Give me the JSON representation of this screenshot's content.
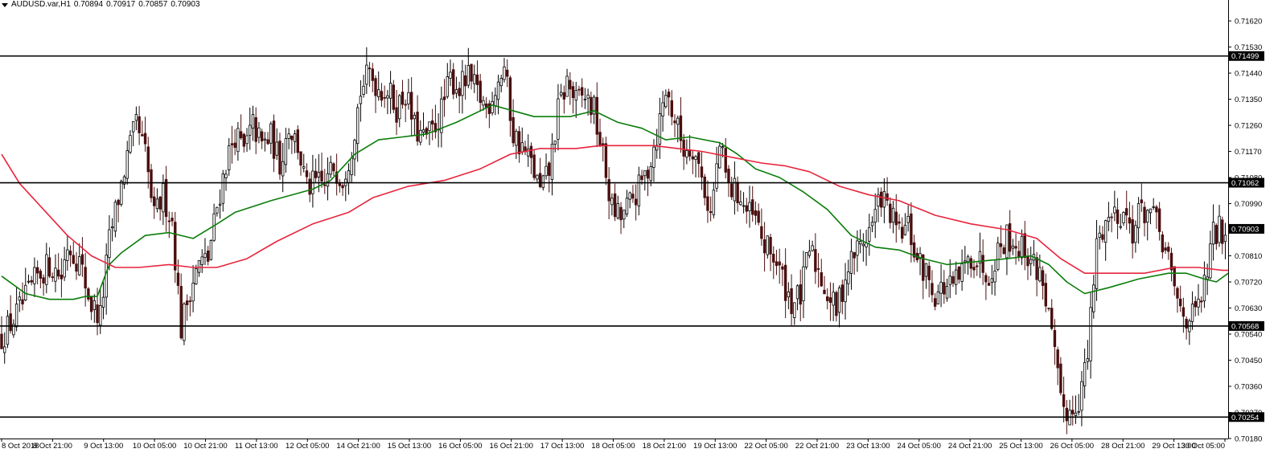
{
  "header": {
    "symbol": "AUDUSD.var,H1",
    "open": "0.70894",
    "high": "0.70917",
    "low": "0.70857",
    "close": "0.70903",
    "menu_icon": "triangle-down-icon"
  },
  "colors": {
    "background": "#ffffff",
    "axis": "#000000",
    "bull_candle": "#000000",
    "bear_candle": "#4a0f0f",
    "ma_fast": "#0a7d0a",
    "ma_slow": "#e8243c",
    "level_line": "#000000",
    "level_label_bg": "#000000",
    "level_label_text": "#ffffff"
  },
  "chart_data": {
    "type": "candlestick",
    "symbol": "AUDUSD",
    "timeframe": "H1",
    "ylim": [
      0.7018,
      0.7167
    ],
    "y_ticks": [
      "0.71620",
      "0.71530",
      "0.71440",
      "0.71350",
      "0.71260",
      "0.71170",
      "0.71080",
      "0.70990",
      "0.70900",
      "0.70810",
      "0.70720",
      "0.70630",
      "0.70540",
      "0.70450",
      "0.70360",
      "0.70270",
      "0.70180"
    ],
    "x_ticks": [
      "8 Oct 2018",
      "8 Oct 21:00",
      "9 Oct 13:00",
      "10 Oct 05:00",
      "10 Oct 21:00",
      "11 Oct 13:00",
      "12 Oct 05:00",
      "14 Oct 21:00",
      "15 Oct 13:00",
      "16 Oct 05:00",
      "16 Oct 21:00",
      "17 Oct 13:00",
      "18 Oct 05:00",
      "18 Oct 21:00",
      "19 Oct 13:00",
      "22 Oct 05:00",
      "22 Oct 21:00",
      "23 Oct 13:00",
      "24 Oct 05:00",
      "24 Oct 21:00",
      "25 Oct 13:00",
      "26 Oct 05:00",
      "28 Oct 21:00",
      "29 Oct 13:00",
      "30 Oct 05:00"
    ],
    "horizontal_levels": [
      {
        "value": 0.71499,
        "label": "0.71499"
      },
      {
        "value": 0.71062,
        "label": "0.71062"
      },
      {
        "value": 0.70568,
        "label": "0.70568"
      },
      {
        "value": 0.70254,
        "label": "0.70254"
      }
    ],
    "current_price": {
      "value": 0.70903,
      "label": "0.70903"
    },
    "close_anchors": [
      [
        0,
        0.7053
      ],
      [
        4,
        0.7059
      ],
      [
        8,
        0.7066
      ],
      [
        12,
        0.7074
      ],
      [
        16,
        0.7078
      ],
      [
        20,
        0.7074
      ],
      [
        22,
        0.7085
      ],
      [
        26,
        0.7079
      ],
      [
        30,
        0.7064
      ],
      [
        33,
        0.706
      ],
      [
        36,
        0.7086
      ],
      [
        39,
        0.7101
      ],
      [
        42,
        0.7115
      ],
      [
        45,
        0.7126
      ],
      [
        48,
        0.7116
      ],
      [
        51,
        0.7094
      ],
      [
        54,
        0.7102
      ],
      [
        57,
        0.7093
      ],
      [
        60,
        0.7056
      ],
      [
        63,
        0.707
      ],
      [
        66,
        0.7078
      ],
      [
        69,
        0.708
      ],
      [
        72,
        0.7098
      ],
      [
        75,
        0.7113
      ],
      [
        78,
        0.7123
      ],
      [
        81,
        0.7117
      ],
      [
        84,
        0.7126
      ],
      [
        87,
        0.7119
      ],
      [
        90,
        0.7122
      ],
      [
        93,
        0.7113
      ],
      [
        96,
        0.7126
      ],
      [
        99,
        0.7119
      ],
      [
        102,
        0.7104
      ],
      [
        105,
        0.7106
      ],
      [
        108,
        0.7105
      ],
      [
        111,
        0.7112
      ],
      [
        114,
        0.7108
      ],
      [
        117,
        0.7119
      ],
      [
        120,
        0.7138
      ],
      [
        123,
        0.7144
      ],
      [
        126,
        0.7139
      ],
      [
        129,
        0.7138
      ],
      [
        132,
        0.7132
      ],
      [
        135,
        0.7137
      ],
      [
        138,
        0.7125
      ],
      [
        141,
        0.7121
      ],
      [
        144,
        0.7124
      ],
      [
        147,
        0.7131
      ],
      [
        150,
        0.7142
      ],
      [
        153,
        0.7139
      ],
      [
        156,
        0.7142
      ],
      [
        159,
        0.7137
      ],
      [
        162,
        0.7132
      ],
      [
        165,
        0.7139
      ],
      [
        168,
        0.7146
      ],
      [
        171,
        0.7123
      ],
      [
        174,
        0.7118
      ],
      [
        177,
        0.7113
      ],
      [
        180,
        0.7103
      ],
      [
        183,
        0.711
      ],
      [
        186,
        0.7131
      ],
      [
        189,
        0.7141
      ],
      [
        192,
        0.7134
      ],
      [
        195,
        0.7136
      ],
      [
        198,
        0.7131
      ],
      [
        201,
        0.7115
      ],
      [
        204,
        0.7097
      ],
      [
        207,
        0.7094
      ],
      [
        210,
        0.7099
      ],
      [
        213,
        0.7104
      ],
      [
        216,
        0.7111
      ],
      [
        219,
        0.7123
      ],
      [
        222,
        0.7138
      ],
      [
        225,
        0.7128
      ],
      [
        228,
        0.7118
      ],
      [
        231,
        0.7119
      ],
      [
        234,
        0.7108
      ],
      [
        237,
        0.7095
      ],
      [
        240,
        0.7119
      ],
      [
        243,
        0.7104
      ],
      [
        246,
        0.7103
      ],
      [
        249,
        0.7096
      ],
      [
        252,
        0.7093
      ],
      [
        255,
        0.7084
      ],
      [
        258,
        0.7081
      ],
      [
        261,
        0.7073
      ],
      [
        264,
        0.7065
      ],
      [
        267,
        0.7067
      ],
      [
        270,
        0.7083
      ],
      [
        273,
        0.7076
      ],
      [
        276,
        0.7068
      ],
      [
        279,
        0.7062
      ],
      [
        282,
        0.7074
      ],
      [
        285,
        0.7082
      ],
      [
        288,
        0.7086
      ],
      [
        291,
        0.7092
      ],
      [
        294,
        0.7102
      ],
      [
        297,
        0.7095
      ],
      [
        300,
        0.7088
      ],
      [
        303,
        0.7091
      ],
      [
        306,
        0.7079
      ],
      [
        309,
        0.7075
      ],
      [
        312,
        0.7068
      ],
      [
        315,
        0.707
      ],
      [
        318,
        0.707
      ],
      [
        321,
        0.7075
      ],
      [
        324,
        0.7081
      ],
      [
        327,
        0.7079
      ],
      [
        330,
        0.7075
      ],
      [
        333,
        0.7083
      ],
      [
        336,
        0.7088
      ],
      [
        339,
        0.7085
      ],
      [
        342,
        0.7083
      ],
      [
        345,
        0.7078
      ],
      [
        348,
        0.7073
      ],
      [
        351,
        0.7053
      ],
      [
        354,
        0.703
      ],
      [
        357,
        0.7027
      ],
      [
        360,
        0.7032
      ],
      [
        363,
        0.7046
      ],
      [
        366,
        0.7085
      ],
      [
        369,
        0.7093
      ],
      [
        372,
        0.7096
      ],
      [
        375,
        0.7096
      ],
      [
        378,
        0.709
      ],
      [
        381,
        0.7097
      ],
      [
        384,
        0.7096
      ],
      [
        387,
        0.7089
      ],
      [
        390,
        0.7078
      ],
      [
        393,
        0.7065
      ],
      [
        396,
        0.706
      ],
      [
        399,
        0.706
      ],
      [
        402,
        0.707
      ],
      [
        405,
        0.7088
      ],
      [
        407,
        0.709
      ]
    ],
    "series": [
      {
        "name": "",
        "type": "moving_average",
        "color": "#0a7d0a",
        "points": [
          [
            0,
            0.7074
          ],
          [
            8,
            0.7068
          ],
          [
            16,
            0.7066
          ],
          [
            24,
            0.7066
          ],
          [
            28,
            0.7067
          ],
          [
            32,
            0.7067
          ],
          [
            36,
            0.7078
          ],
          [
            40,
            0.7082
          ],
          [
            48,
            0.7088
          ],
          [
            56,
            0.7089
          ],
          [
            64,
            0.7087
          ],
          [
            72,
            0.7092
          ],
          [
            78,
            0.7096
          ],
          [
            90,
            0.71
          ],
          [
            104,
            0.7104
          ],
          [
            110,
            0.7107
          ],
          [
            118,
            0.7116
          ],
          [
            126,
            0.7121
          ],
          [
            134,
            0.7122
          ],
          [
            142,
            0.7123
          ],
          [
            152,
            0.7127
          ],
          [
            164,
            0.7133
          ],
          [
            178,
            0.7129
          ],
          [
            190,
            0.7129
          ],
          [
            198,
            0.7131
          ],
          [
            206,
            0.7127
          ],
          [
            214,
            0.7125
          ],
          [
            222,
            0.7121
          ],
          [
            230,
            0.7122
          ],
          [
            240,
            0.712
          ],
          [
            246,
            0.7116
          ],
          [
            252,
            0.7111
          ],
          [
            260,
            0.7108
          ],
          [
            268,
            0.7103
          ],
          [
            276,
            0.7097
          ],
          [
            284,
            0.7088
          ],
          [
            292,
            0.7084
          ],
          [
            300,
            0.7083
          ],
          [
            308,
            0.708
          ],
          [
            316,
            0.7078
          ],
          [
            326,
            0.7079
          ],
          [
            336,
            0.708
          ],
          [
            344,
            0.7081
          ],
          [
            350,
            0.7078
          ],
          [
            356,
            0.7072
          ],
          [
            362,
            0.7068
          ],
          [
            370,
            0.707
          ],
          [
            380,
            0.7073
          ],
          [
            390,
            0.7075
          ],
          [
            396,
            0.7075
          ],
          [
            402,
            0.7073
          ],
          [
            406,
            0.7072
          ],
          [
            410,
            0.7075
          ]
        ]
      },
      {
        "name": "",
        "type": "moving_average",
        "color": "#e8243c",
        "points": [
          [
            0,
            0.7116
          ],
          [
            6,
            0.7106
          ],
          [
            14,
            0.7097
          ],
          [
            22,
            0.7088
          ],
          [
            30,
            0.7081
          ],
          [
            38,
            0.7077
          ],
          [
            46,
            0.7077
          ],
          [
            56,
            0.7078
          ],
          [
            64,
            0.7077
          ],
          [
            72,
            0.7077
          ],
          [
            82,
            0.708
          ],
          [
            92,
            0.7086
          ],
          [
            104,
            0.7092
          ],
          [
            116,
            0.7096
          ],
          [
            124,
            0.7101
          ],
          [
            136,
            0.7105
          ],
          [
            148,
            0.7107
          ],
          [
            160,
            0.7111
          ],
          [
            170,
            0.7116
          ],
          [
            180,
            0.7118
          ],
          [
            192,
            0.7118
          ],
          [
            200,
            0.7119
          ],
          [
            210,
            0.7119
          ],
          [
            218,
            0.7119
          ],
          [
            226,
            0.7118
          ],
          [
            234,
            0.7117
          ],
          [
            244,
            0.7115
          ],
          [
            254,
            0.7113
          ],
          [
            262,
            0.7112
          ],
          [
            270,
            0.711
          ],
          [
            280,
            0.7105
          ],
          [
            290,
            0.7102
          ],
          [
            300,
            0.71
          ],
          [
            312,
            0.7095
          ],
          [
            324,
            0.7092
          ],
          [
            336,
            0.709
          ],
          [
            346,
            0.7087
          ],
          [
            354,
            0.708
          ],
          [
            362,
            0.7075
          ],
          [
            372,
            0.7075
          ],
          [
            382,
            0.7075
          ],
          [
            392,
            0.7077
          ],
          [
            400,
            0.7077
          ],
          [
            408,
            0.7076
          ],
          [
            410,
            0.7076
          ]
        ]
      }
    ],
    "legend": "none",
    "grid": false
  }
}
